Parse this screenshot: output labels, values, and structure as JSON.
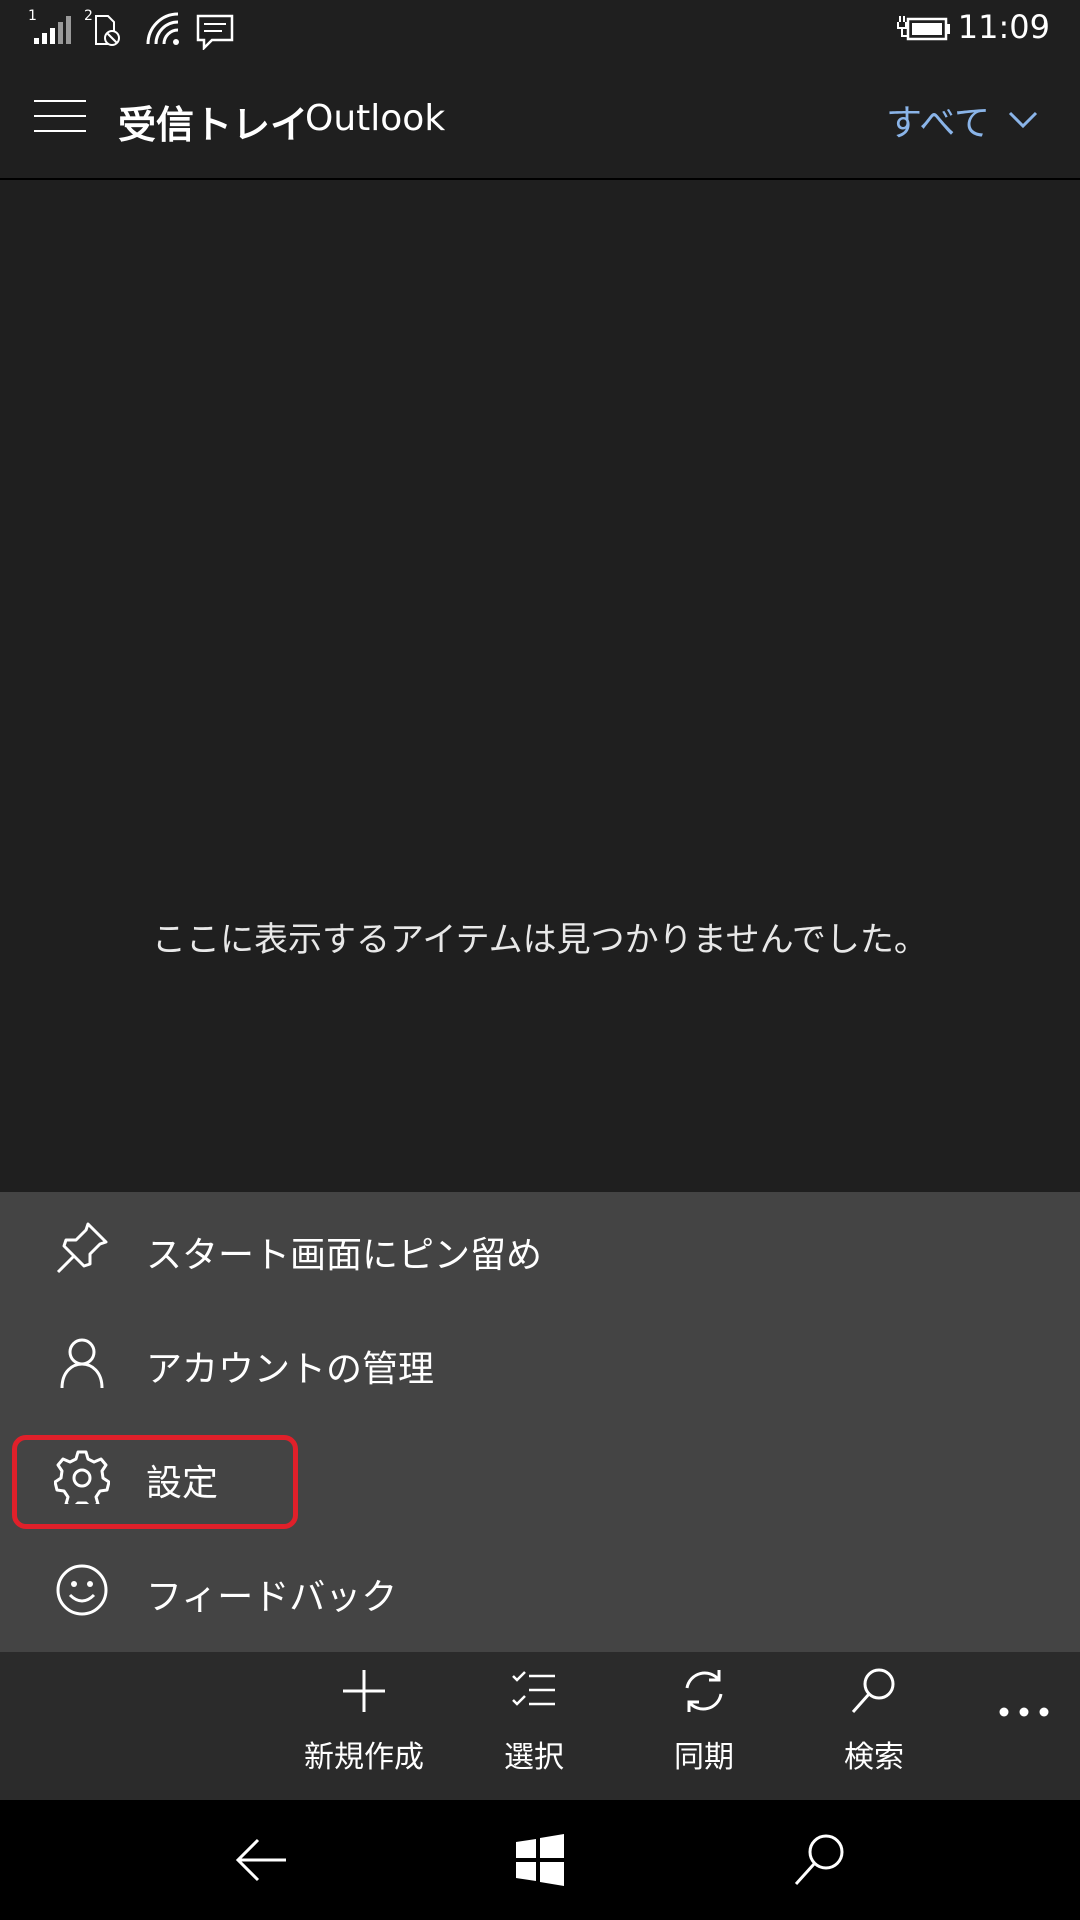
{
  "status": {
    "sim1": "1",
    "sim2": "2",
    "time": "11:09"
  },
  "header": {
    "title": "受信トレイ",
    "subtitle": "Outlook",
    "filter_label": "すべて"
  },
  "content": {
    "empty_message": "ここに表示するアイテムは見つかりませんでした。"
  },
  "menu": {
    "items": [
      {
        "label": "スタート画面にピン留め",
        "icon": "pin-icon"
      },
      {
        "label": "アカウントの管理",
        "icon": "person-icon"
      },
      {
        "label": "設定",
        "icon": "gear-icon"
      },
      {
        "label": "フィードバック",
        "icon": "smiley-icon"
      }
    ],
    "highlight_color": "#e0202a"
  },
  "appbar": {
    "buttons": [
      {
        "label": "新規作成",
        "icon": "plus-icon"
      },
      {
        "label": "選択",
        "icon": "checklist-icon"
      },
      {
        "label": "同期",
        "icon": "sync-icon"
      },
      {
        "label": "検索",
        "icon": "search-icon"
      }
    ]
  },
  "colors": {
    "background": "#1f1f1f",
    "menu": "#444444",
    "appbar": "#2b2b2b",
    "accent": "#8ab4e8"
  }
}
